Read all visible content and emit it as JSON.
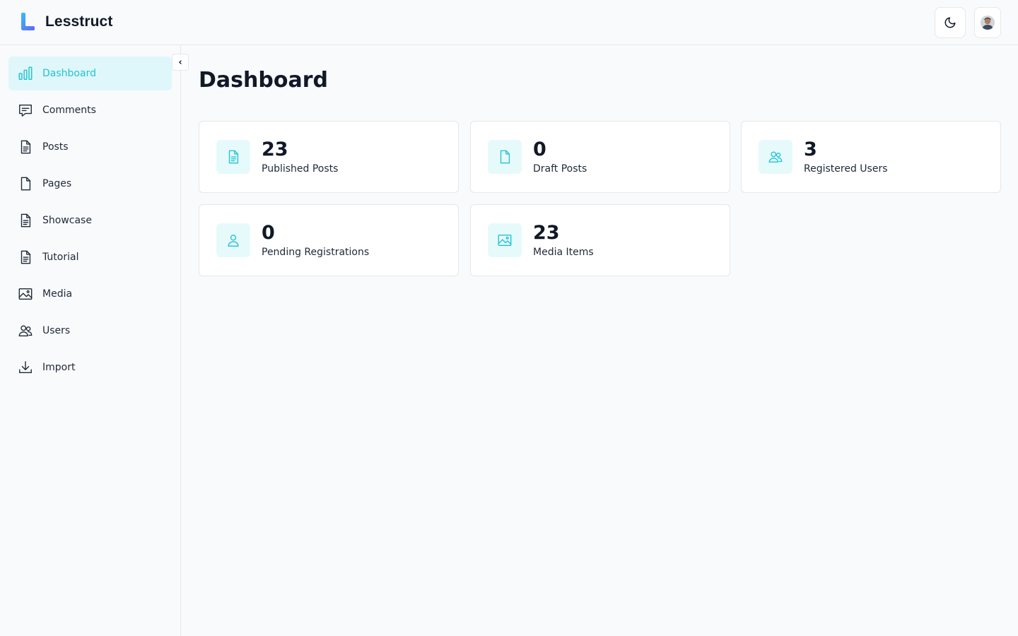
{
  "app": {
    "name": "Lesstruct"
  },
  "header": {
    "theme_toggle_icon": "moon-icon",
    "avatar_icon": "user-avatar"
  },
  "sidebar": {
    "collapse_label": "‹",
    "items": [
      {
        "label": "Dashboard",
        "icon": "bar-chart-icon",
        "active": true
      },
      {
        "label": "Comments",
        "icon": "comment-icon"
      },
      {
        "label": "Posts",
        "icon": "document-text-icon"
      },
      {
        "label": "Pages",
        "icon": "document-icon"
      },
      {
        "label": "Showcase",
        "icon": "document-text-icon"
      },
      {
        "label": "Tutorial",
        "icon": "document-text-icon"
      },
      {
        "label": "Media",
        "icon": "image-icon"
      },
      {
        "label": "Users",
        "icon": "users-icon"
      },
      {
        "label": "Import",
        "icon": "download-icon"
      }
    ]
  },
  "main": {
    "title": "Dashboard",
    "stats": [
      {
        "value": "23",
        "label": "Published Posts",
        "icon": "document-text-icon"
      },
      {
        "value": "0",
        "label": "Draft Posts",
        "icon": "document-icon"
      },
      {
        "value": "3",
        "label": "Registered Users",
        "icon": "users-icon"
      },
      {
        "value": "0",
        "label": "Pending Registrations",
        "icon": "user-icon"
      },
      {
        "value": "23",
        "label": "Media Items",
        "icon": "image-icon"
      }
    ]
  },
  "colors": {
    "accent": "#22c3d3",
    "active_bg": "#dff7fa",
    "icon_bg": "#e6fafc",
    "border": "#e5e7eb",
    "background": "#f8fafc"
  }
}
